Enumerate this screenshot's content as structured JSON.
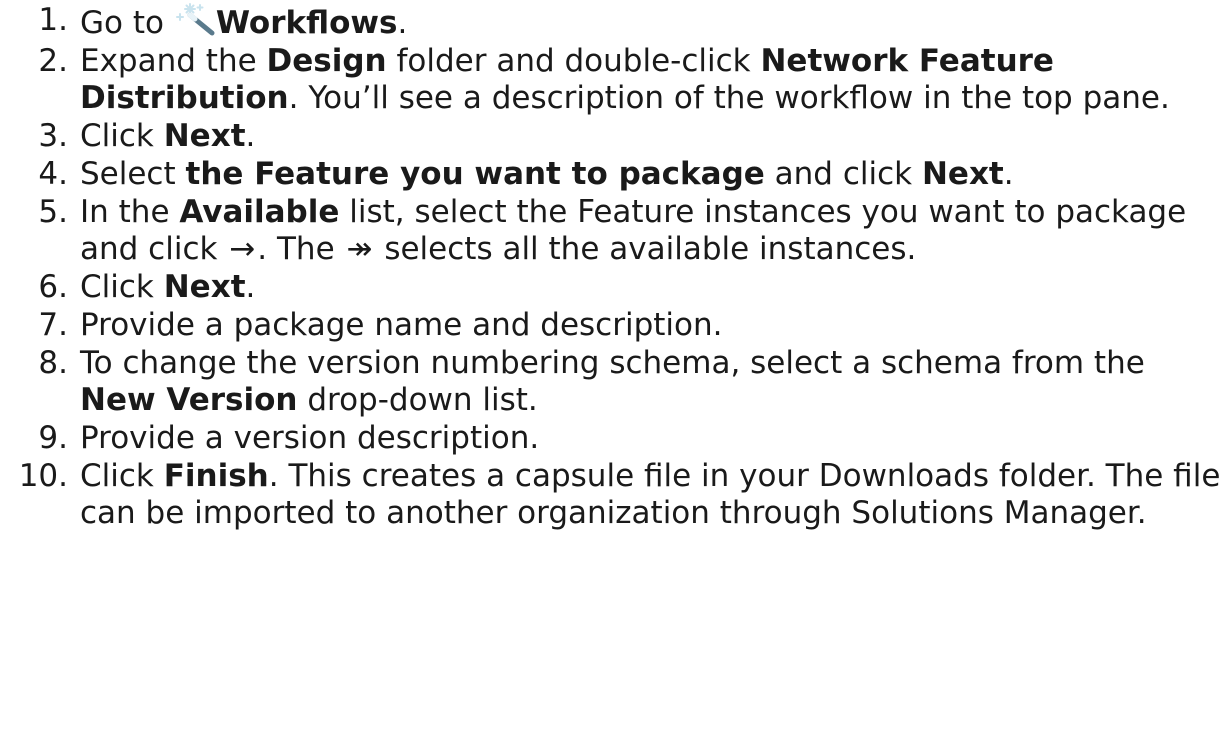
{
  "steps": [
    {
      "num": "1.",
      "segments": [
        {
          "text": "Go to "
        },
        {
          "icon": "magic-wand-icon"
        },
        {
          "text": "Workflows",
          "bold": true
        },
        {
          "text": "."
        }
      ]
    },
    {
      "num": "2.",
      "segments": [
        {
          "text": "Expand the "
        },
        {
          "text": "Design",
          "bold": true
        },
        {
          "text": " folder and double-click "
        },
        {
          "text": "Network Feature Distribution",
          "bold": true
        },
        {
          "text": ". You’ll see a description of the workflow in the top pane."
        }
      ]
    },
    {
      "num": "3.",
      "segments": [
        {
          "text": "Click "
        },
        {
          "text": "Next",
          "bold": true
        },
        {
          "text": "."
        }
      ]
    },
    {
      "num": "4.",
      "segments": [
        {
          "text": "Select "
        },
        {
          "text": "the Feature you want to package",
          "bold": true
        },
        {
          "text": " and click "
        },
        {
          "text": "Next",
          "bold": true
        },
        {
          "text": "."
        }
      ]
    },
    {
      "num": "5.",
      "segments": [
        {
          "text": "In the "
        },
        {
          "text": "Available",
          "bold": true
        },
        {
          "text": " list, select the Feature instances you want to package and click "
        },
        {
          "arrow": "→",
          "icon": "right-arrow-icon"
        },
        {
          "text": ". The "
        },
        {
          "arrow": "↠",
          "icon": "double-right-arrow-icon"
        },
        {
          "text": " selects all the available instances."
        }
      ]
    },
    {
      "num": "6.",
      "segments": [
        {
          "text": "Click "
        },
        {
          "text": "Next",
          "bold": true
        },
        {
          "text": "."
        }
      ]
    },
    {
      "num": "7.",
      "segments": [
        {
          "text": "Provide a package name and description."
        }
      ]
    },
    {
      "num": "8.",
      "segments": [
        {
          "text": "To change the version numbering schema, select a schema from the "
        },
        {
          "text": "New Version",
          "bold": true
        },
        {
          "text": " drop-down list."
        }
      ]
    },
    {
      "num": "9.",
      "segments": [
        {
          "text": "Provide a version description."
        }
      ]
    },
    {
      "num": "10.",
      "segments": [
        {
          "text": "Click "
        },
        {
          "text": "Finish",
          "bold": true
        },
        {
          "text": ". This creates a capsule file in your Downloads folder. The file can be imported to another organization through Solutions Manager."
        }
      ]
    }
  ]
}
